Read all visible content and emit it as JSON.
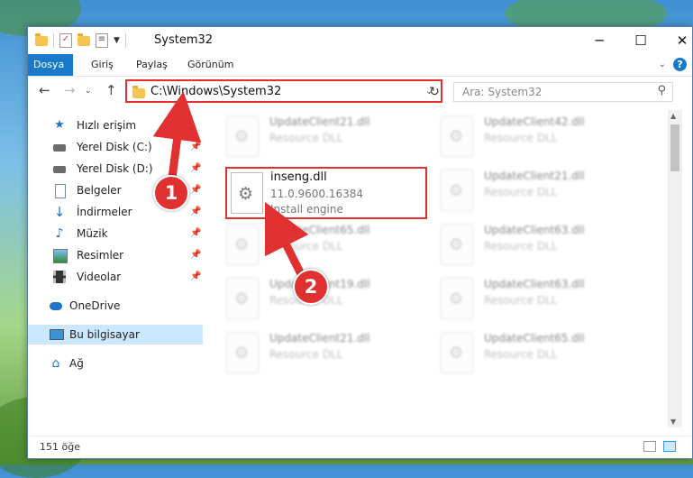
{
  "window": {
    "title": "System32",
    "controls": {
      "minimize": "─",
      "maximize": "☐",
      "close": "✕"
    }
  },
  "ribbon": {
    "tabs": [
      "Dosya",
      "Giriş",
      "Paylaş",
      "Görünüm"
    ],
    "help": "?"
  },
  "navigation": {
    "address": "C:\\Windows\\System32",
    "search_placeholder": "Ara: System32"
  },
  "sidebar": {
    "items": [
      {
        "label": "Hızlı erişim",
        "icon": "star-icon"
      },
      {
        "label": "Yerel Disk (C:)",
        "icon": "drive-icon",
        "pinned": true
      },
      {
        "label": "Yerel Disk (D:)",
        "icon": "drive-icon",
        "pinned": true
      },
      {
        "label": "Belgeler",
        "icon": "documents-icon",
        "pinned": true
      },
      {
        "label": "İndirmeler",
        "icon": "downloads-icon",
        "pinned": true
      },
      {
        "label": "Müzik",
        "icon": "music-icon",
        "pinned": true
      },
      {
        "label": "Resimler",
        "icon": "pictures-icon",
        "pinned": true
      },
      {
        "label": "Videolar",
        "icon": "videos-icon",
        "pinned": true
      },
      {
        "label": "OneDrive",
        "icon": "onedrive-icon"
      },
      {
        "label": "Bu bilgisayar",
        "icon": "this-pc-icon",
        "selected": true
      },
      {
        "label": "Ağ",
        "icon": "network-icon"
      }
    ]
  },
  "files": {
    "highlighted": {
      "name": "inseng.dll",
      "version": "11.0.9600.16384",
      "description": "Install engine"
    },
    "others": [
      {
        "name": "UpdateClient21.dll",
        "description": "Resource DLL"
      },
      {
        "name": "UpdateClient42.dll",
        "description": "Resource DLL"
      },
      {
        "name": "UpdateClient21.dll",
        "description": "Resource DLL"
      },
      {
        "name": "UpdateClient65.dll",
        "description": "Resource DLL"
      },
      {
        "name": "UpdateClient63.dll",
        "description": "Resource DLL"
      },
      {
        "name": "UpdateClient19.dll",
        "description": "Resource DLL"
      },
      {
        "name": "UpdateClient63.dll",
        "description": "Resource DLL"
      },
      {
        "name": "UpdateClient21.dll",
        "description": "Resource DLL"
      },
      {
        "name": "UpdateClient65.dll",
        "description": "Resource DLL"
      }
    ]
  },
  "status": {
    "item_count": "151 öğe"
  },
  "callouts": [
    "1",
    "2"
  ],
  "colors": {
    "highlight_red": "#e03030",
    "accent_blue": "#1979ca"
  }
}
